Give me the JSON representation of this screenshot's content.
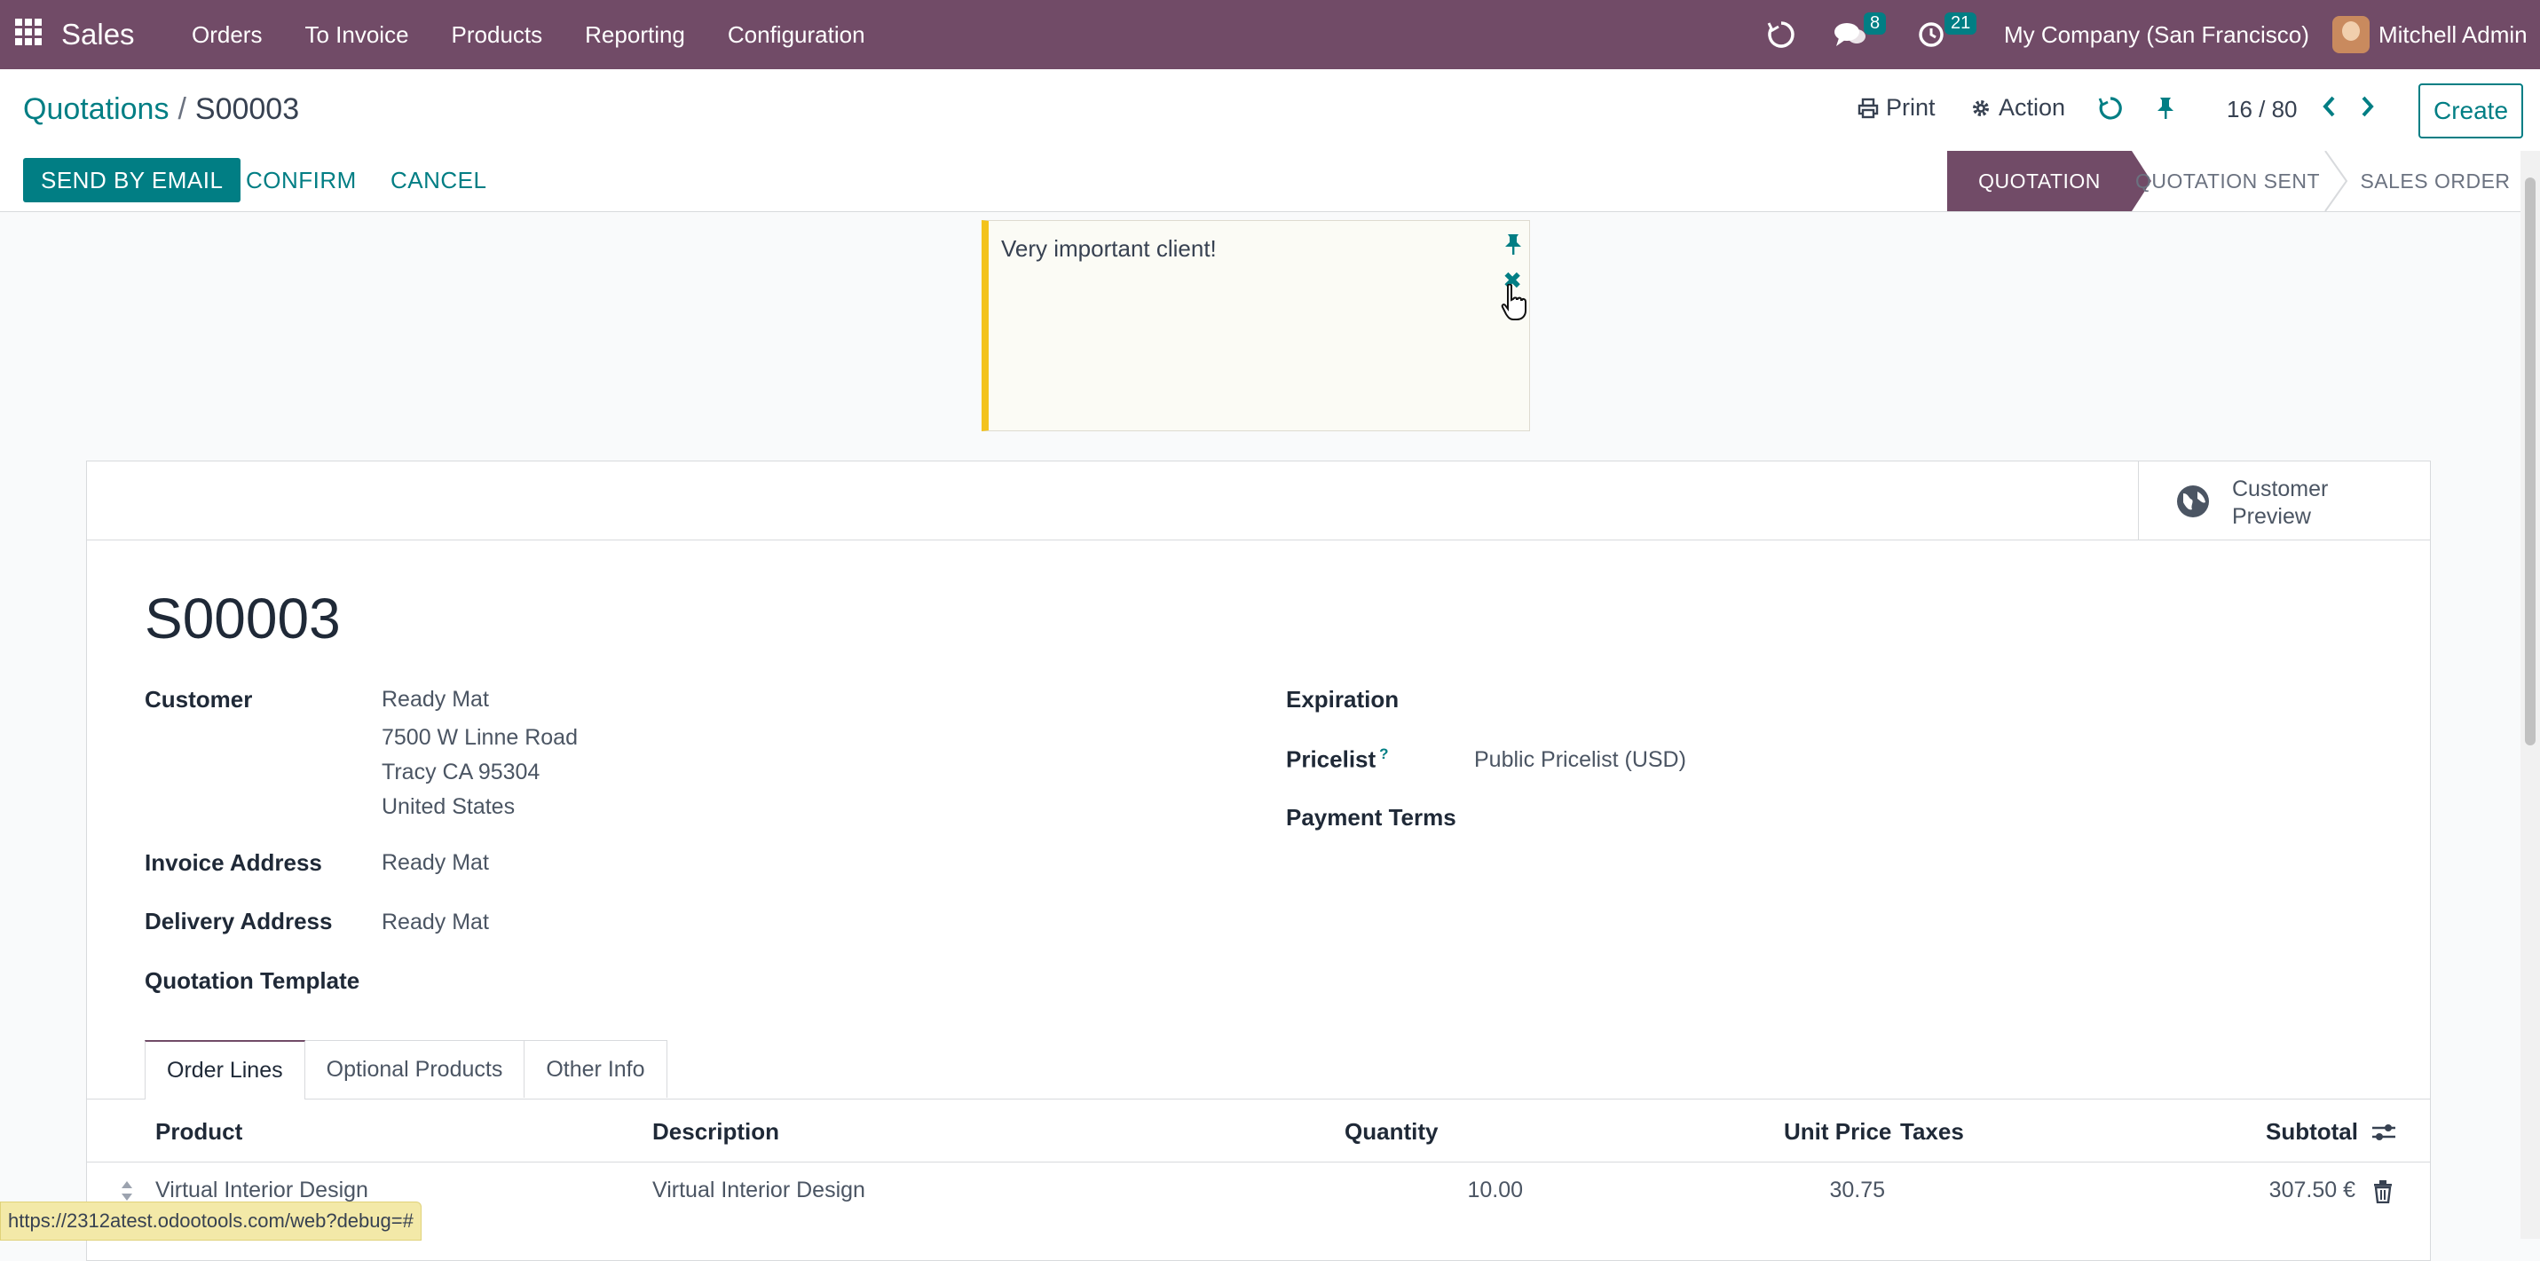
{
  "navbar": {
    "app_name": "Sales",
    "menu": [
      "Orders",
      "To Invoice",
      "Products",
      "Reporting",
      "Configuration"
    ],
    "messages_count": "8",
    "activities_count": "21",
    "company": "My Company (San Francisco)",
    "user": "Mitchell Admin"
  },
  "control": {
    "breadcrumb_parent": "Quotations",
    "breadcrumb_sep": "/",
    "breadcrumb_current": "S00003",
    "print_label": "Print",
    "action_label": "Action",
    "pager": "16 / 80",
    "create_label": "Create"
  },
  "statusbar": {
    "send_label": "SEND BY EMAIL",
    "confirm_label": "CONFIRM",
    "cancel_label": "CANCEL",
    "stages": [
      "QUOTATION",
      "QUOTATION SENT",
      "SALES ORDER"
    ]
  },
  "note": {
    "text": "Very important client!"
  },
  "sheet": {
    "customer_preview_line1": "Customer",
    "customer_preview_line2": "Preview",
    "order_name": "S00003",
    "customer_label": "Customer",
    "customer_name": "Ready Mat",
    "customer_street": "7500 W Linne Road",
    "customer_city": "Tracy CA 95304",
    "customer_country": "United States",
    "invoice_address_label": "Invoice Address",
    "invoice_address": "Ready Mat",
    "delivery_address_label": "Delivery Address",
    "delivery_address": "Ready Mat",
    "quotation_template_label": "Quotation Template",
    "expiration_label": "Expiration",
    "pricelist_label": "Pricelist",
    "pricelist_help": "?",
    "pricelist_value": "Public Pricelist (USD)",
    "payment_terms_label": "Payment Terms"
  },
  "tabs": [
    "Order Lines",
    "Optional Products",
    "Other Info"
  ],
  "table": {
    "headers": {
      "product": "Product",
      "description": "Description",
      "quantity": "Quantity",
      "unit_price": "Unit Price",
      "taxes": "Taxes",
      "subtotal": "Subtotal"
    },
    "rows": [
      {
        "product": "Virtual Interior Design",
        "description": "Virtual Interior Design",
        "quantity": "10.00",
        "unit_price": "30.75",
        "taxes": "",
        "subtotal": "307.50 €"
      }
    ]
  },
  "status_url": "https://2312atest.odootools.com/web?debug=#",
  "colors": {
    "brand": "#714b67",
    "accent": "#017e84",
    "note_border": "#f3c31c"
  }
}
